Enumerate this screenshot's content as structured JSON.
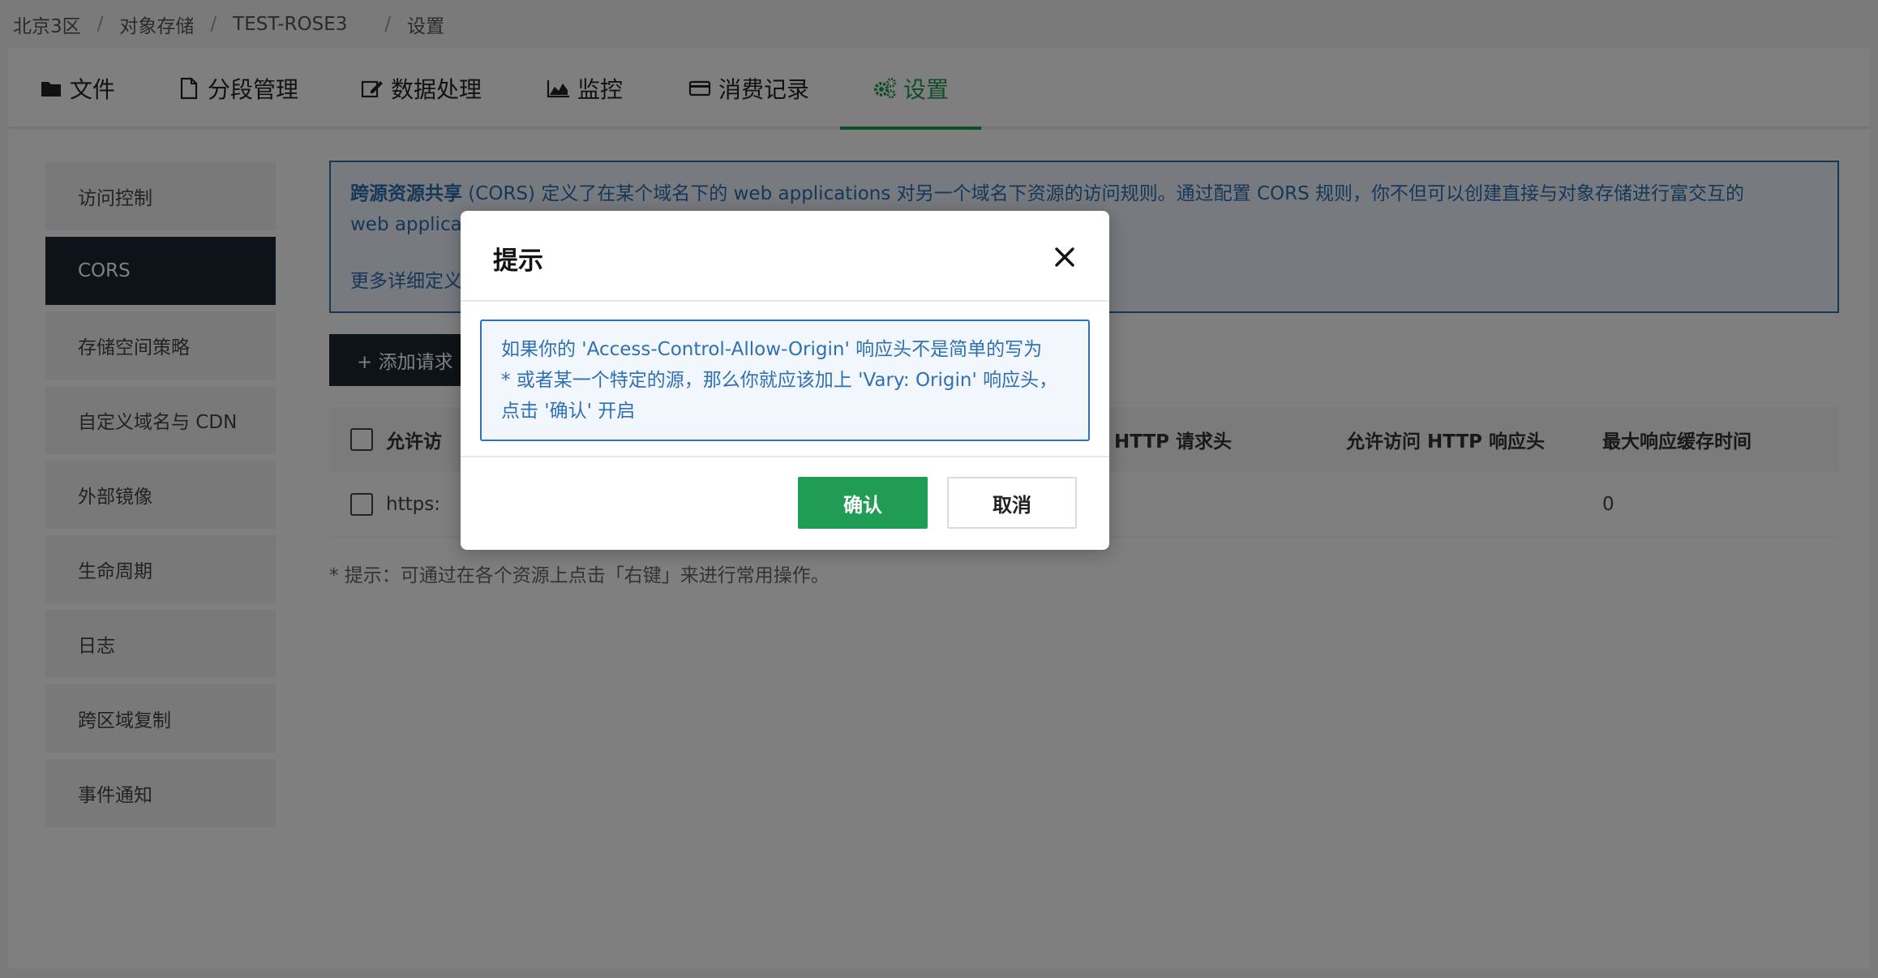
{
  "breadcrumb": {
    "items": [
      "北京3区",
      "对象存储",
      "TEST-ROSE3",
      "设置"
    ],
    "separator": "/"
  },
  "tabs": [
    {
      "label": "文件",
      "icon": "folder-icon"
    },
    {
      "label": "分段管理",
      "icon": "document-icon"
    },
    {
      "label": "数据处理",
      "icon": "edit-icon"
    },
    {
      "label": "监控",
      "icon": "area-chart-icon"
    },
    {
      "label": "消费记录",
      "icon": "credit-card-icon"
    },
    {
      "label": "设置",
      "icon": "gears-icon",
      "active": true
    }
  ],
  "sidebar": {
    "items": [
      {
        "label": "访问控制"
      },
      {
        "label": "CORS",
        "active": true
      },
      {
        "label": "存储空间策略"
      },
      {
        "label": "自定义域名与 CDN"
      },
      {
        "label": "外部镜像"
      },
      {
        "label": "生命周期"
      },
      {
        "label": "日志"
      },
      {
        "label": "跨区域复制"
      },
      {
        "label": "事件通知"
      }
    ]
  },
  "notice": {
    "bold": "跨源资源共享",
    "text": " (CORS) 定义了在某个域名下的 web applications 对另一个域名下资源的访问规则。通过配置 CORS 规则，你不但可以创建直接与对象存储进行富交互的",
    "line2": "web applica",
    "more": "更多详细定义"
  },
  "add_button": {
    "label": "+ 添加请求"
  },
  "table": {
    "headers": [
      "允许访",
      "HTTP 请求头",
      "允许访问 HTTP 响应头",
      "最大响应缓存时间"
    ],
    "rows": [
      {
        "origin": "https:",
        "max_age": "0"
      }
    ]
  },
  "hint": "* 提示：可通过在各个资源上点击「右键」来进行常用操作。",
  "modal": {
    "title": "提示",
    "body_line1": "如果你的 'Access-Control-Allow-Origin' 响应头不是简单的写为",
    "body_line2": "* 或者某一个特定的源，那么你就应该加上 'Vary: Origin' 响应头，",
    "body_line3": "点击 '确认' 开启",
    "confirm": "确认",
    "cancel": "取消"
  },
  "colors": {
    "accent_green": "#1f9d55",
    "info_blue": "#2f6fb3",
    "dark_nav": "#1c2733"
  }
}
